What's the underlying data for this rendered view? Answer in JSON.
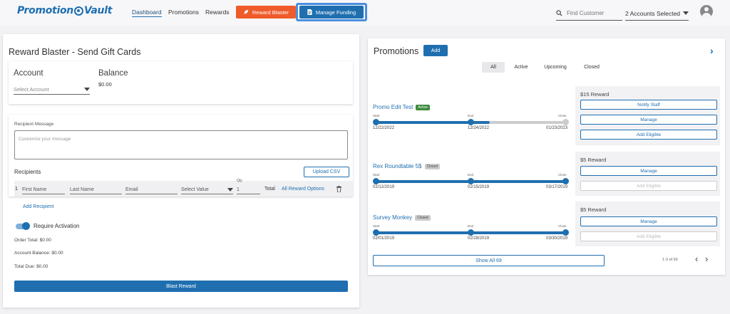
{
  "header": {
    "logo": "Promotion Vault",
    "nav": [
      "Dashboard",
      "Promotions",
      "Rewards"
    ],
    "reward_blaster": "Reward Blaster",
    "manage_funding": "Manage Funding",
    "find_customer_placeholder": "Find Customer",
    "accounts_selected": "2 Accounts Selected"
  },
  "left": {
    "title": "Reward Blaster - Send Gift Cards",
    "account_label": "Account",
    "account_placeholder": "Select Account",
    "balance_label": "Balance",
    "balance_value": "$0.00",
    "recipient_message_label": "Recipient Message",
    "message_placeholder": "Customize your message",
    "recipients_label": "Recipients",
    "upload_csv": "Upload CSV",
    "row": {
      "index": "1",
      "first_name": "First Name",
      "last_name": "Last Name",
      "email": "Email",
      "select_value": "Select Value",
      "qty_label": "Qty",
      "qty_value": "1",
      "total": "Total",
      "all_options": "All Reward Options"
    },
    "add_recipient": "Add Recipient",
    "require_activation": "Require Activation",
    "order_total": "Order Total: $0.00",
    "account_balance": "Account Balance: $0.00",
    "total_due": "Total Due: $0.00",
    "blast_reward": "Blast Reward"
  },
  "right": {
    "title": "Promotions",
    "add": "Add",
    "filters": [
      "All",
      "Active",
      "Upcoming",
      "Closed"
    ],
    "timeline_labels": {
      "start": "Start",
      "end": "End",
      "close": "Close"
    },
    "promotions": [
      {
        "name": "Promo Edit Test",
        "status": "Active",
        "start": "12/22/2022",
        "end": "12/24/2022",
        "close": "01/23/2023",
        "reward": "$15 Reward",
        "buttons": [
          "Notify Staff",
          "Manage",
          "Add Eligible"
        ]
      },
      {
        "name": "Rex Roundtable 5$",
        "status": "Closed",
        "start": "02/12/2019",
        "end": "02/15/2019",
        "close": "03/17/2019",
        "reward": "$5 Reward",
        "buttons": [
          "Manage",
          "Add Eligible"
        ]
      },
      {
        "name": "Survey Monkey",
        "status": "Closed",
        "start": "02/01/2019",
        "end": "02/28/2019",
        "close": "03/30/2019",
        "reward": "$5 Reward",
        "buttons": [
          "Manage",
          "Add Eligible"
        ]
      }
    ],
    "show_all": "Show All 69",
    "pager": "1-3 of 69"
  }
}
